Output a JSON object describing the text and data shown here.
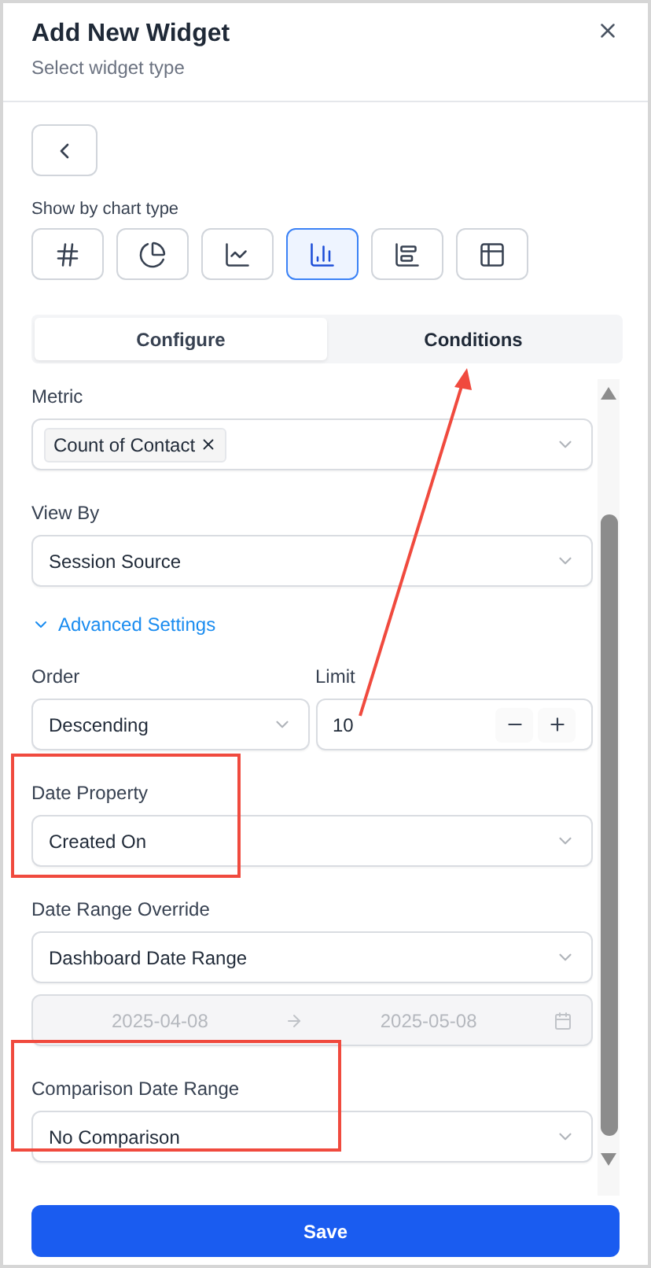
{
  "dialog": {
    "title": "Add New Widget",
    "subtitle": "Select widget type"
  },
  "chart_type_label": "Show by chart type",
  "chart_types": [
    {
      "kind": "number",
      "selected": false
    },
    {
      "kind": "pie",
      "selected": false
    },
    {
      "kind": "line",
      "selected": false
    },
    {
      "kind": "bar",
      "selected": true
    },
    {
      "kind": "hbar",
      "selected": false
    },
    {
      "kind": "table",
      "selected": false
    }
  ],
  "tabs": [
    {
      "label": "Configure",
      "selected": true
    },
    {
      "label": "Conditions",
      "selected": false
    }
  ],
  "metric": {
    "label": "Metric",
    "tags": [
      "Count of Contact"
    ]
  },
  "view_by": {
    "label": "View By",
    "value": "Session Source"
  },
  "advanced": {
    "label": "Advanced Settings",
    "expanded": true
  },
  "order": {
    "label": "Order",
    "value": "Descending"
  },
  "limit": {
    "label": "Limit",
    "value": "10"
  },
  "date_property": {
    "label": "Date Property",
    "value": "Created On"
  },
  "date_range_override": {
    "label": "Date Range Override",
    "value": "Dashboard Date Range"
  },
  "date_range": {
    "start": "2025-04-08",
    "end": "2025-05-08",
    "disabled": true
  },
  "comparison": {
    "label": "Comparison Date Range",
    "value": "No Comparison"
  },
  "save": "Save"
}
